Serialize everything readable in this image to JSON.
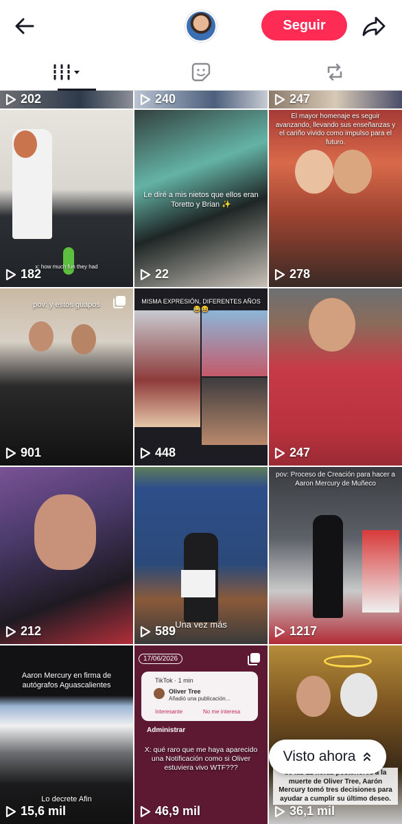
{
  "header": {
    "follow_label": "Seguir",
    "accent_color": "#fe2c55"
  },
  "tabs": [
    {
      "icon": "grid-icon",
      "active": true
    },
    {
      "icon": "sticker-icon",
      "active": false
    },
    {
      "icon": "repost-icon",
      "active": false
    }
  ],
  "videos": [
    {
      "views": "202"
    },
    {
      "views": "240"
    },
    {
      "views": "247"
    },
    {
      "views": "182",
      "caption": "x: how much fun they had"
    },
    {
      "views": "22",
      "caption": "Le diré a mis nietos que ellos eran Toretto y Brian ✨"
    },
    {
      "views": "278",
      "caption": "El mayor homenaje es seguir avanzando, llevando sus enseñanzas y el cariño vivido como impulso para el futuro."
    },
    {
      "views": "901",
      "caption": "pov: y estos guapos"
    },
    {
      "views": "448",
      "caption": "MISMA EXPRESIÓN, DIFERENTES AÑOS 😂😆"
    },
    {
      "views": "247"
    },
    {
      "views": "212"
    },
    {
      "views": "589",
      "caption": "Una vez más"
    },
    {
      "views": "1217",
      "caption": "pov: Proceso de Creación para hacer a Aaron Mercury de Muñeco"
    },
    {
      "views": "15,6 mil",
      "caption": "Aaron Mercury en firma de autógrafos Aguascalientes",
      "caption2": "Lo decrete Afin"
    },
    {
      "views": "46,9 mil",
      "caption": "X: qué raro que me haya aparecido una Notificación como si Oliver estuviera vivo WTF???",
      "date": "17/06/2026",
      "notif_app": "TikTok · 1 min",
      "notif_name": "Oliver Tree",
      "notif_msg": "Añadió una publicación...",
      "notif_btn1": "Interesante",
      "notif_btn2": "No me interesa",
      "admin": "Administrar"
    },
    {
      "views": "36,1 mil",
      "caption": "de las 12 horas posteriores a la muerte de Oliver Tree, Aarón Mercury tomó tres decisiones para ayudar a cumplir su último deseo."
    }
  ],
  "visto_ahora": {
    "label": "Visto ahora"
  }
}
